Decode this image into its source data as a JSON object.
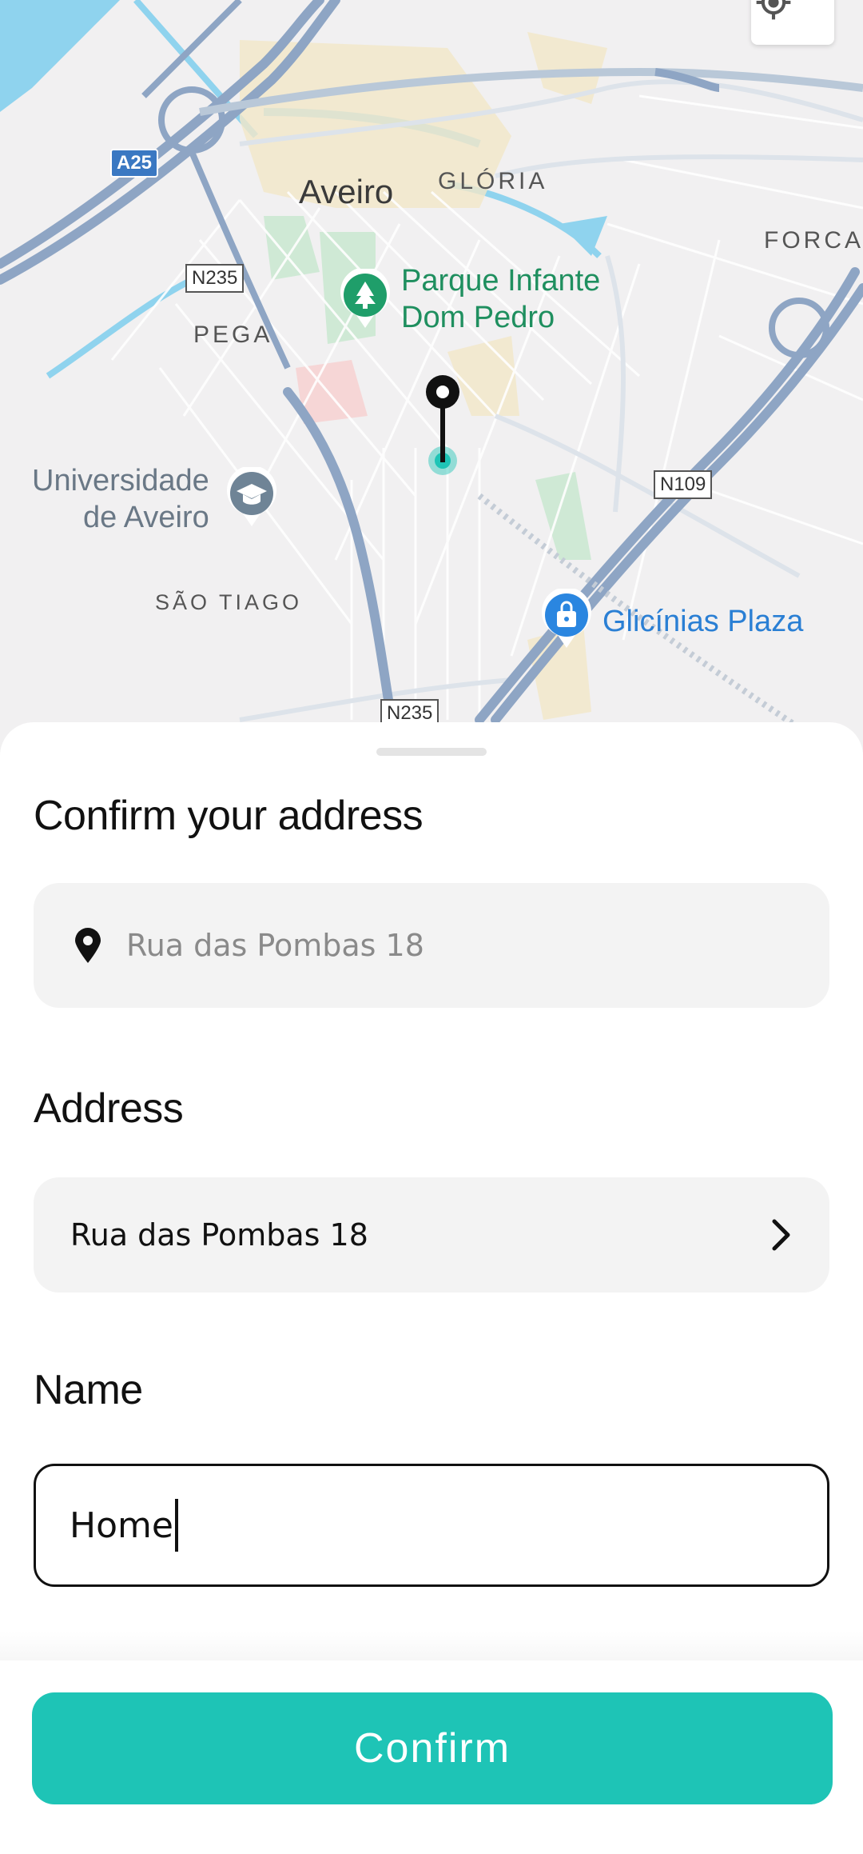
{
  "map": {
    "labels": {
      "city": "Aveiro",
      "gloria": "GLÓRIA",
      "forca": "FORCA",
      "pega": "PEGA",
      "sao_tiago": "SÃO TIAGO",
      "park_line1": "Parque Infante",
      "park_line2": "Dom Pedro",
      "univ_line1": "Universidade",
      "univ_line2": "de Aveiro",
      "plaza": "Glicínias Plaza"
    },
    "shields": {
      "a25": "A25",
      "n235_top": "N235",
      "n235_bottom": "N235",
      "n109": "N109"
    },
    "colors": {
      "land": "#f1f0f1",
      "water": "#8fd3ee",
      "highway": "#8ea5c4",
      "park": "#1f8f5f",
      "pin_accent": "#1ec4b6"
    }
  },
  "sheet": {
    "title": "Confirm your address",
    "search_placeholder": "Rua das Pombas 18",
    "address_label": "Address",
    "address_value": "Rua das Pombas 18",
    "name_label": "Name",
    "name_value": "Home"
  },
  "actions": {
    "confirm_label": "Confirm",
    "accent_color": "#1ec4b6"
  },
  "icons": {
    "locate": "crosshair-location-icon",
    "search": "map-pin-icon",
    "address": "chevron-right-icon",
    "map_pin": "drop-pin-marker-icon",
    "park": "tree-icon",
    "university": "graduation-cap-icon",
    "plaza": "shopping-bag-icon"
  }
}
